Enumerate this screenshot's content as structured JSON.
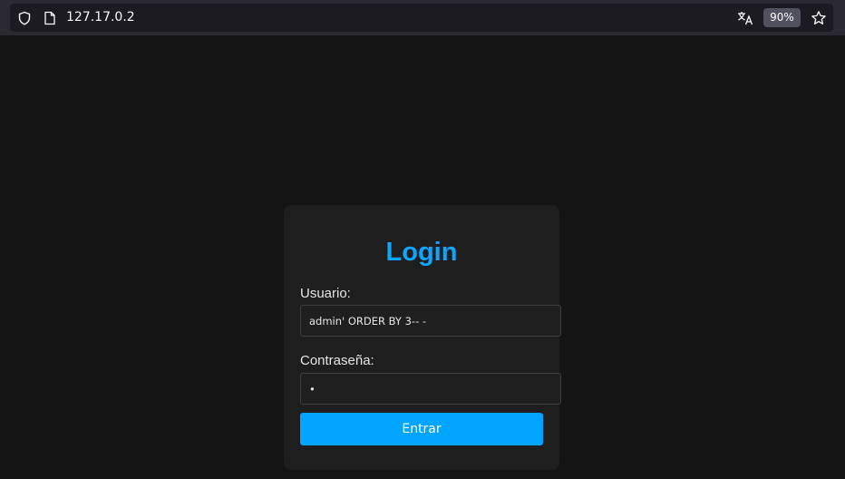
{
  "browser": {
    "url": "127.17.0.2",
    "zoom": "90%",
    "icons": {
      "site_info": "shield-icon",
      "page": "page-icon",
      "translate": "translate-icon",
      "bookmark": "star-icon"
    }
  },
  "login": {
    "title": "Login",
    "username_label": "Usuario:",
    "username_value": "admin' ORDER BY 3-- -",
    "password_label": "Contraseña:",
    "password_value": "x",
    "submit_label": "Entrar"
  },
  "colors": {
    "accent": "#00a5ff",
    "title": "#0ea5ff",
    "page_background": "#141414",
    "card_background": "#1e1e1e"
  }
}
